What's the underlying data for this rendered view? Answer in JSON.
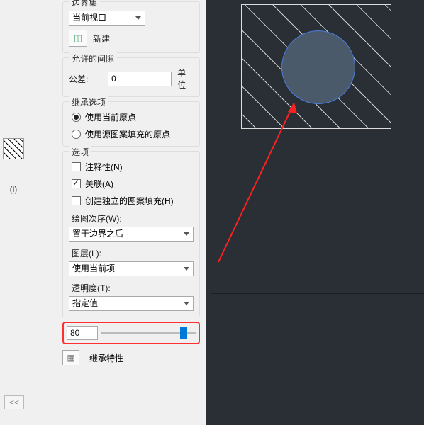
{
  "left": {
    "hatch_label": "(I)"
  },
  "boundary": {
    "title": "边界集",
    "viewport_select": "当前视口",
    "new_btn": "新建"
  },
  "gap": {
    "title": "允许的间隙",
    "tolerance_label": "公差:",
    "tolerance_value": "0",
    "unit": "单位"
  },
  "inherit_opts": {
    "title": "继承选项",
    "use_current": "使用当前原点",
    "use_source": "使用源图案填充的原点"
  },
  "options": {
    "title": "选项",
    "annotative": "注释性(N)",
    "associative": "关联(A)",
    "independent": "创建独立的图案填充(H)",
    "draw_order_label": "绘图次序(W):",
    "draw_order_value": "置于边界之后",
    "layer_label": "图层(L):",
    "layer_value": "使用当前项",
    "transparency_label": "透明度(T):",
    "transparency_value": "指定值"
  },
  "slider": {
    "value": "80",
    "percent": 80
  },
  "inherit": {
    "icon_label": "inherit-props-icon",
    "label": "继承特性"
  },
  "collapse": "<<"
}
